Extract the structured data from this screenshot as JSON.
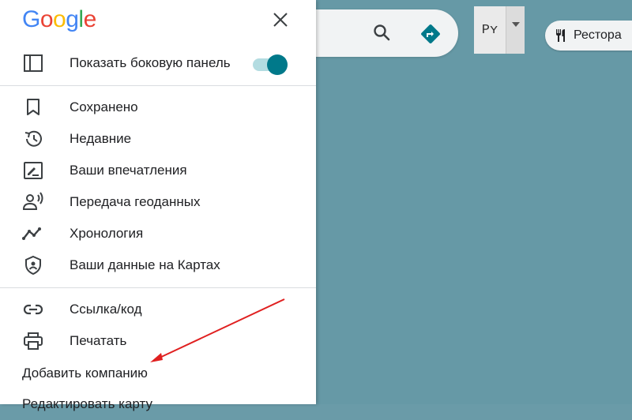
{
  "drawer": {
    "logo": [
      "G",
      "o",
      "o",
      "g",
      "l",
      "e"
    ],
    "logo_colors": [
      "#4285F4",
      "#EA4335",
      "#FBBC05",
      "#4285F4",
      "#34A853",
      "#EA4335"
    ],
    "sidebar_toggle_label": "Показать боковую панель",
    "sidebar_toggle_on": true,
    "items": [
      {
        "label": "Сохранено",
        "icon": "bookmark-icon"
      },
      {
        "label": "Недавние",
        "icon": "history-icon"
      },
      {
        "label": "Ваши впечатления",
        "icon": "contributions-icon"
      },
      {
        "label": "Передача геоданных",
        "icon": "location-sharing-icon"
      },
      {
        "label": "Хронология",
        "icon": "timeline-icon"
      },
      {
        "label": "Ваши данные на Картах",
        "icon": "shield-icon"
      }
    ],
    "items2": [
      {
        "label": "Ссылка/код",
        "icon": "link-icon"
      },
      {
        "label": "Печатать",
        "icon": "print-icon"
      }
    ],
    "text_items": [
      "Добавить компанию",
      "Редактировать карту"
    ]
  },
  "map": {
    "language_label": "Рʏ",
    "chip_label": "Рестора"
  },
  "colors": {
    "accent": "#00798a",
    "map_water": "#6699a6",
    "annotation_arrow": "#e02020"
  }
}
